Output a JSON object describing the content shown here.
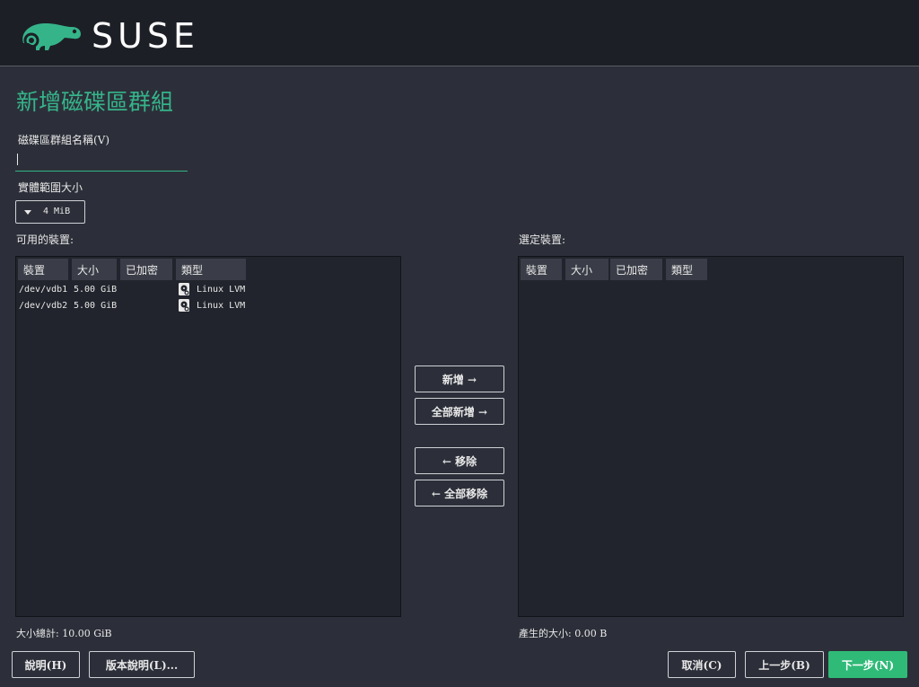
{
  "brand": {
    "name": "SUSE",
    "accent": "#35b48a"
  },
  "page_title": "新增磁碟區群組",
  "vg_name": {
    "label": "磁碟區群組名稱(V)",
    "value": ""
  },
  "extent_size": {
    "label": "實體範圍大小",
    "value": "4 MiB"
  },
  "available": {
    "label": "可用的裝置:",
    "columns": [
      "裝置",
      "大小",
      "已加密",
      "類型"
    ],
    "rows": [
      {
        "device": "/dev/vdb1",
        "size": "5.00 GiB",
        "encrypted": "",
        "type": "Linux LVM",
        "type_icon": "hard-disk-icon"
      },
      {
        "device": "/dev/vdb2",
        "size": "5.00 GiB",
        "encrypted": "",
        "type": "Linux LVM",
        "type_icon": "hard-disk-icon"
      }
    ],
    "total": "大小總計: 10.00 GiB"
  },
  "selected": {
    "label": "選定裝置:",
    "columns": [
      "裝置",
      "大小",
      "已加密",
      "類型"
    ],
    "rows": [],
    "total": "產生的大小: 0.00 B"
  },
  "actions": {
    "add": "新增 →",
    "add_all": "全部新增 →",
    "remove": "← 移除",
    "remove_all": "← 全部移除"
  },
  "footer": {
    "help": "說明(H)",
    "release_notes": "版本說明(L)...",
    "cancel": "取消(C)",
    "back": "上一步(B)",
    "next": "下一步(N)"
  }
}
